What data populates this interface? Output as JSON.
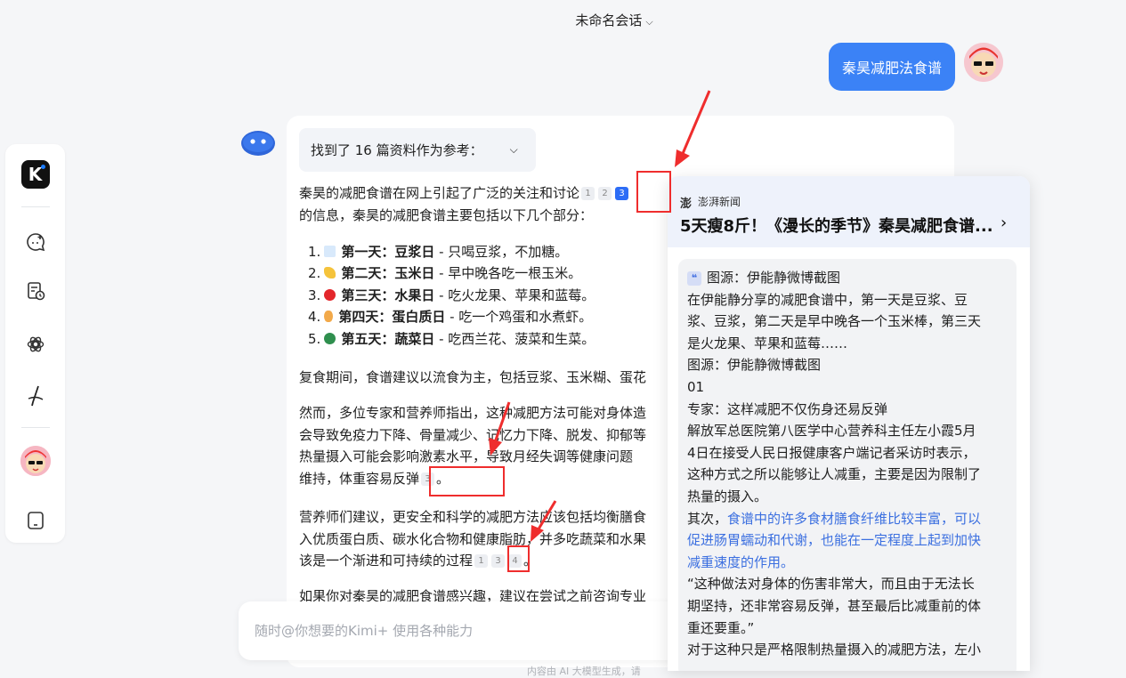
{
  "header": {
    "title": "未命名会话"
  },
  "sidebar": {
    "logo_letter": "K",
    "items": [
      "new-chat-icon",
      "history-icon",
      "explore-icon",
      "pen-icon",
      "avatar",
      "phone-icon"
    ]
  },
  "user_message": "秦昊减肥法食谱",
  "reference": {
    "label": "找到了 16 篇资料作为参考："
  },
  "answer": {
    "intro_line1": "秦昊的减肥食谱在网上引起了广泛的关注和讨论",
    "intro_line2": "的信息，秦昊的减肥食谱主要包括以下几个部分：",
    "list": [
      {
        "n": "1.",
        "day": "第一天：豆浆日",
        "desc": " - 只喝豆浆，不加糖。",
        "color": "#cfe3fb"
      },
      {
        "n": "2.",
        "day": "第二天：玉米日",
        "desc": " - 早中晚各吃一根玉米。",
        "color": "#f5c33b"
      },
      {
        "n": "3.",
        "day": "第三天：水果日",
        "desc": " - 吃火龙果、苹果和蓝莓。",
        "color": "#e3262b"
      },
      {
        "n": "4.",
        "day": "第四天：蛋白质日",
        "desc": " - 吃一个鸡蛋和水煮虾。",
        "color": "#f2a94a"
      },
      {
        "n": "5.",
        "day": "第五天：蔬菜日",
        "desc": " - 吃西兰花、菠菜和生菜。",
        "color": "#2f8f4e"
      }
    ],
    "p2": "复食期间，食谱建议以流食为主，包括豆浆、玉米糊、蛋花",
    "p3_l1": "然而，多位专家和营养师指出，这种减肥方法可能对身体造",
    "p3_l2": "会导致免疫力下降、骨量减少、记忆力下降、脱发、抑郁等",
    "p3_l3": "热量摄入可能会影响激素水平，导致月经失调等健康问题",
    "p3_l4": "维持，体重容易反弹",
    "p4_l1": "营养师们建议，更安全和科学的减肥方法应该包括均衡膳食",
    "p4_l2": "入优质蛋白质、碳水化合物和健康脂肪，并多吃蔬菜和水果",
    "p4_l3": "该是一个渐进和可持续的过程",
    "p5": "如果你对秦昊的减肥食谱感兴趣，建议在尝试之前咨询专业",
    "period": "。"
  },
  "citations": {
    "c1": "1",
    "c2": "2",
    "c3": "3",
    "c4": "4"
  },
  "input": {
    "placeholder": "随时@你想要的Kimi+ 使用各种能力"
  },
  "footer": "内容由 AI 大模型生成，请",
  "popup": {
    "source": "澎湃新闻",
    "title": "5天瘦8斤！《漫长的季节》秦昊减肥食谱...",
    "quote_lines": [
      "图源：伊能静微博截图",
      "在伊能静分享的减肥食谱中，第一天是豆浆、豆",
      "浆、豆浆，第二天是早中晚各一个玉米棒，第三天",
      "是火龙果、苹果和蓝莓……",
      "图源：伊能静微博截图",
      "01",
      "专家：这样减肥不仅伤身还易反弹",
      "解放军总医院第八医学中心营养科主任左小霞5月",
      "4日在接受人民日报健康客户端记者采访时表示，",
      "这种方式之所以能够让人减重，主要是因为限制了",
      "热量的摄入。",
      "其次，",
      "食谱中的许多食材膳食纤维比较丰富，可以",
      "促进肠胃蠕动和代谢，也能在一定程度上起到加快",
      "减重速度的作用。",
      "“这种做法对身体的伤害非常大，而且由于无法长",
      "期坚持，还非常容易反弹，甚至最后比减重前的体",
      "重还要重。”",
      "对于这种只是严格限制热量摄入的减肥方法，左小"
    ]
  }
}
